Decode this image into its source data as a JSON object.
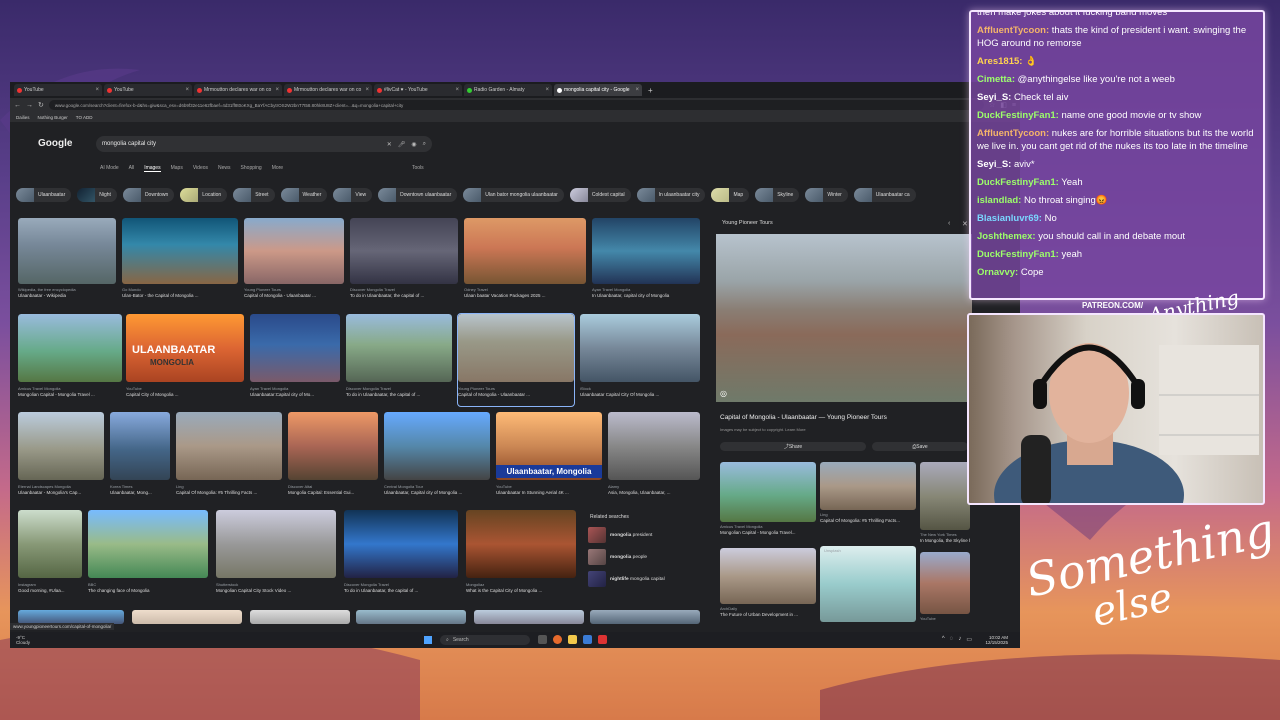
{
  "browser": {
    "tabs": [
      {
        "label": "YouTube",
        "active": false
      },
      {
        "label": "YouTube",
        "active": false
      },
      {
        "label": "Mrmoutton declares war on co",
        "active": false
      },
      {
        "label": "Mrmoutton declares war on co",
        "active": false
      },
      {
        "label": "#livCat ♥ - YouTube",
        "active": false
      },
      {
        "label": "Radio Garden - Almaty",
        "active": false
      },
      {
        "label": "mongolia capital city - Google",
        "active": true
      }
    ],
    "new_tab": "+",
    "url": "www.google.com/search?client=firefox-b-d&hs=giw&sca_esv=d6b9f32e11e62fbaef=4d31ff8t0oKXg_BaYfACbytrOS2W2bnT7t58.80hk8U8Z+client=...&q=mongolia+capital+city",
    "bookmarks": [
      "Dailies",
      "Nothing Burger",
      "TO ADD"
    ]
  },
  "google": {
    "logo": "Google",
    "query": "mongolia capital city",
    "tabs": [
      "AI Mode",
      "All",
      "Images",
      "Maps",
      "Videos",
      "News",
      "Shopping",
      "More"
    ],
    "active_tab": "Images",
    "tools": "Tools",
    "chips": [
      "Ulaanbaatar",
      "Night",
      "Downtown",
      "Location",
      "Street",
      "Weather",
      "View",
      "Downtown ulaanbaatar",
      "Ulan bator mongolia ulaanbaatar",
      "Coldest capital",
      "In ulaanbaatar city",
      "Map",
      "Skyline",
      "Winter",
      "Ulaanbaatar ca"
    ]
  },
  "results": [
    {
      "src": "Wikipedia, the free encyclopedia",
      "title": "Ulaanbaatar - Wikipedia"
    },
    {
      "src": "Go Mundo",
      "title": "Ulan-Bator - the Capital of Mongolia ..."
    },
    {
      "src": "Young Pioneer Tours",
      "title": "Capital of Mongolia - Ulaanbaatar ..."
    },
    {
      "src": "Discover Mongolia Travel",
      "title": "To do in Ulaanbaatar, the capital of ..."
    },
    {
      "src": "Odney Travel",
      "title": "Ulaan baatar Vacation Packages 2025 ..."
    },
    {
      "src": "Ayan Travel Mongolia",
      "title": "In Ulaanbaatar, capital city of Mongolia"
    },
    {
      "src": "Amicus Travel Mongolia",
      "title": "Mongolian Capital - Mongolia Travel ..."
    },
    {
      "src": "YouTube",
      "title": "Capital City of Mongolia ..."
    },
    {
      "src": "Ayan Travel Mongolia",
      "title": "Ulaanbaatar:Capital city of Mo..."
    },
    {
      "src": "Discover Mongolia Travel",
      "title": "To do in Ulaanbaatar, the capital of ..."
    },
    {
      "src": "Young Pioneer Tours",
      "title": "Capital of Mongolia - Ulaanbaatar ..."
    },
    {
      "src": "iStock",
      "title": "Ulaanbaatar Capital City Of Mongolia ..."
    },
    {
      "src": "Eternal Landscapes Mongolia",
      "title": "Ulaanbaatar - Mongolia's Cap..."
    },
    {
      "src": "Korea Times",
      "title": "Ulaanbaatar, Mong..."
    },
    {
      "src": "Ling",
      "title": "Capital Of Mongolia: #5 Thrilling Facts ..."
    },
    {
      "src": "Discover Altai",
      "title": "Mongolia Capital: Essential Gui..."
    },
    {
      "src": "Central Mongolia Tour",
      "title": "Ulaanbaatar, Capital city of Mongolia ..."
    },
    {
      "src": "YouTube",
      "title": "Ulaanbaatar In Stunning Aerial 4K ..."
    },
    {
      "src": "Alamy",
      "title": "Asia, Mongolia, Ulaanbaatar, ..."
    },
    {
      "src": "Instagram",
      "title": "Good morning, #Ulaa..."
    },
    {
      "src": "BBC",
      "title": "The changing face of Mongolia"
    },
    {
      "src": "Shutterstock",
      "title": "Mongolian Capital City Stock Video ..."
    },
    {
      "src": "Discover Mongolia Travel",
      "title": "To do in Ulaanbaatar, the capital of ..."
    },
    {
      "src": "Mongoliaz",
      "title": "What is the Capital City of Mongolia ..."
    }
  ],
  "overlay_text": {
    "thumb_title": "ULAANBAATAR",
    "thumb_sub": "MONGOLIA",
    "banner": "Ulaanbaatar, Mongolia"
  },
  "related": {
    "heading": "Related searches",
    "items": [
      {
        "bold": "mongolia",
        "rest": " president"
      },
      {
        "bold": "mongolia",
        "rest": " people"
      },
      {
        "bold": "nightlife",
        "rest": " mongolia capital"
      }
    ]
  },
  "panel": {
    "source": "Young Pioneer Tours",
    "title": "Capital of Mongolia - Ulaanbaatar — Young Pioneer Tours",
    "note": "Images may be subject to copyright. Learn More",
    "share": "Share",
    "save": "Save",
    "more": [
      {
        "src": "Amicus Travel Mongolia",
        "title": "Mongolian Capital - Mongolia Travel..."
      },
      {
        "src": "Ling",
        "title": "Capital Of Mongolia: #5 Thrilling Facts..."
      },
      {
        "src": "The New York Times",
        "title": "In Mongolia, the Skyline by the Steppes ..."
      },
      {
        "src": "ArchDaily",
        "title": "The Future of Urban Development in ..."
      },
      {
        "src": "Unsplash",
        "title": ""
      },
      {
        "src": "YouTube",
        "title": ""
      }
    ]
  },
  "status_url": "www.youngpioneertours.com/capital-of-mongolia/",
  "taskbar": {
    "weather_temp": "-9°C",
    "weather_desc": "Cloudy",
    "search": "Search",
    "time": "10:02 AM",
    "date": "12/15/2025"
  },
  "stream": {
    "patreon": "PATREON.COM/",
    "brand": "Anything else?",
    "brand_big_1": "Something",
    "brand_big_2": "else"
  },
  "chat": [
    {
      "user": "",
      "color": "#ffffff",
      "text": "then make jokes about it fucking band moves"
    },
    {
      "user": "AffluentTycoon:",
      "color": "#f4b46a",
      "text": "thats the kind of president i want. swinging the HOG around no remorse"
    },
    {
      "user": "Ares1815:",
      "color": "#ffd34f",
      "text": "👌"
    },
    {
      "user": "Cimetta:",
      "color": "#9cff6a",
      "text": "@anythingelse like you're not a weeb"
    },
    {
      "user": "Seyi_S:",
      "color": "#ffffff",
      "text": "Check tel aiv"
    },
    {
      "user": "DuckFestinyFan1:",
      "color": "#9cff6a",
      "text": "name one good movie or tv show"
    },
    {
      "user": "AffluentTycoon:",
      "color": "#f4b46a",
      "text": "nukes are for horrible situations but its the world we live in. you cant get rid of the nukes its too late in the timeline"
    },
    {
      "user": "Seyi_S:",
      "color": "#ffffff",
      "text": "aviv*"
    },
    {
      "user": "DuckFestinyFan1:",
      "color": "#9cff6a",
      "text": "Yeah"
    },
    {
      "user": "islandlad:",
      "color": "#9cff6a",
      "text": "No throat singing😡"
    },
    {
      "user": "Blasianluvr69:",
      "color": "#7ad7ff",
      "text": "No"
    },
    {
      "user": "Joshthemex:",
      "color": "#9cff6a",
      "text": "you should call in and debate mout"
    },
    {
      "user": "DuckFestinyFan1:",
      "color": "#9cff6a",
      "text": "yeah"
    },
    {
      "user": "Ornavvy:",
      "color": "#9cff6a",
      "text": "Cope"
    }
  ]
}
